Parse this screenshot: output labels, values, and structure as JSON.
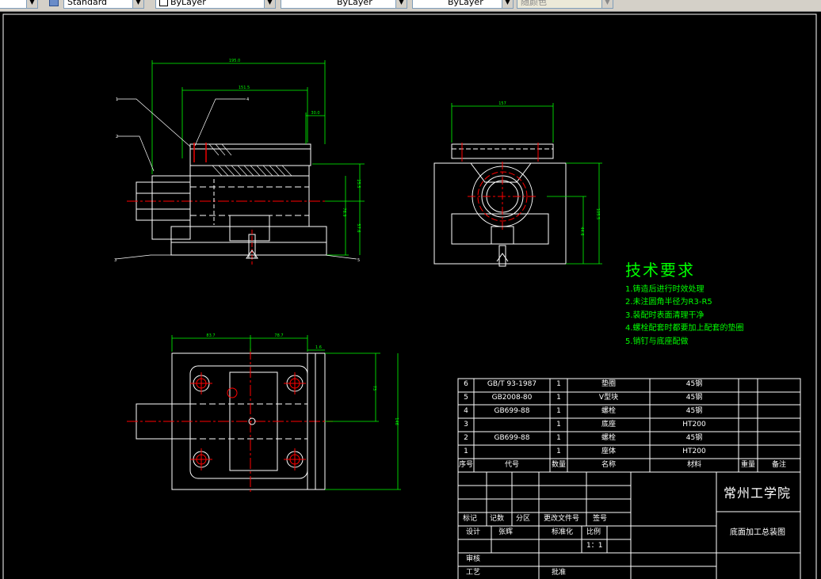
{
  "toolbar": {
    "text_style": "Standard",
    "layer_color": "ByLayer",
    "linetype": "ByLayer",
    "lineweight": "ByLayer",
    "plot_style": "随颜色"
  },
  "dimensions": {
    "front_overall": "195.0",
    "front_sub": "151.5",
    "front_top": "30.0",
    "front_h1": "25.5",
    "front_h2": "76.9",
    "front_h3": "57.6",
    "side_top": "157",
    "side_h1": "105.5",
    "side_h2": "44.6",
    "top_left": "83.7",
    "top_right": "78.7",
    "top_small": "1.6",
    "top_h1": "73",
    "top_h2": "146"
  },
  "balloons": [
    "1",
    "2",
    "3",
    "4",
    "5"
  ],
  "tech_requirements": {
    "title": "技术要求",
    "items": [
      "1.铸造后进行时效处理",
      "2.未注圆角半径为R3-R5",
      "3.装配时表面清理干净",
      "4.螺栓配套时都要加上配套的垫圈",
      "5.销钉与底座配做"
    ]
  },
  "parts_list": {
    "rows": [
      {
        "no": "6",
        "code": "GB/T 93-1987",
        "qty": "1",
        "name": "垫圈",
        "material": "45钢"
      },
      {
        "no": "5",
        "code": "GB2008-80",
        "qty": "1",
        "name": "V型块",
        "material": "45钢"
      },
      {
        "no": "4",
        "code": "GB699-88",
        "qty": "1",
        "name": "螺栓",
        "material": "45钢"
      },
      {
        "no": "3",
        "code": "",
        "qty": "1",
        "name": "底座",
        "material": "HT200"
      },
      {
        "no": "2",
        "code": "GB699-88",
        "qty": "1",
        "name": "螺栓",
        "material": "45钢"
      },
      {
        "no": "1",
        "code": "",
        "qty": "1",
        "name": "座体",
        "material": "HT200"
      }
    ],
    "header": {
      "no": "序号",
      "code": "代号",
      "qty": "数量",
      "name": "名称",
      "material": "材料",
      "weight": "重量",
      "remarks": "备注"
    }
  },
  "title_block": {
    "school": "常州工学院",
    "drawing_name": "底面加工总装图",
    "mark": "标记",
    "count": "记数",
    "zone": "分区",
    "change_doc": "更改文件号",
    "sign": "签号",
    "design": "设计",
    "designer": "张辉",
    "standardize": "标准化",
    "scale_label": "比例",
    "scale": "1：1",
    "review": "审核",
    "process": "工艺",
    "approve": "批准"
  }
}
